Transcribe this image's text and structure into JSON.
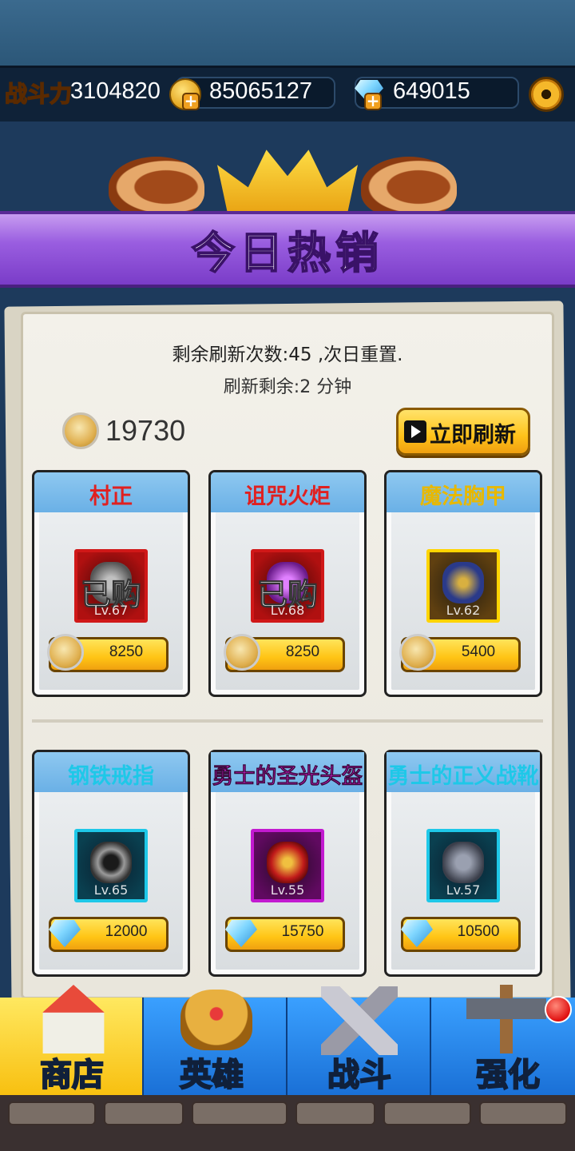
{
  "header": {
    "power_label": "战斗力",
    "power_value": "3104820",
    "gold_value": "85065127",
    "gem_value": "649015",
    "gold_icon": "gold-coin-icon",
    "gem_icon": "diamond-icon",
    "settings_icon": "gear-icon"
  },
  "banner": {
    "title": "今日热销"
  },
  "shop": {
    "refresh_count_text": "剩余刷新次数:45 ,次日重置.",
    "refresh_remain_text": "刷新剩余:2 分钟",
    "honor_value": "19730",
    "refresh_button_label": "立即刷新",
    "items": [
      {
        "name": "村正",
        "name_color": "#e02020",
        "level": "Lv.67",
        "sold": "已购",
        "price": "8250",
        "currency": "honor",
        "frame": "red"
      },
      {
        "name": "诅咒火炬",
        "name_color": "#e02020",
        "level": "Lv.68",
        "sold": "已购",
        "price": "8250",
        "currency": "honor",
        "frame": "red"
      },
      {
        "name": "魔法胸甲",
        "name_color": "#f0c000",
        "level": "Lv.62",
        "sold": "",
        "price": "5400",
        "currency": "honor",
        "frame": "gold"
      },
      {
        "name": "钢铁戒指",
        "name_color": "#1ec8e8",
        "level": "Lv.65",
        "sold": "",
        "price": "12000",
        "currency": "diamond",
        "frame": "cyan"
      },
      {
        "name": "勇士的圣光头盔",
        "name_color": "#e020e0",
        "level": "Lv.55",
        "sold": "",
        "price": "15750",
        "currency": "diamond",
        "frame": "purple"
      },
      {
        "name": "勇士的正义战靴",
        "name_color": "#1ec8e8",
        "level": "Lv.57",
        "sold": "",
        "price": "10500",
        "currency": "diamond",
        "frame": "cyan"
      }
    ]
  },
  "nav": {
    "tabs": [
      {
        "label": "商店",
        "icon": "shop-icon",
        "active": true
      },
      {
        "label": "英雄",
        "icon": "hero-helmet-icon",
        "active": false
      },
      {
        "label": "战斗",
        "icon": "crossed-swords-icon",
        "active": false
      },
      {
        "label": "强化",
        "icon": "forge-hammer-icon",
        "active": false
      }
    ]
  },
  "colors": {
    "accent_gold": "#ffc21a",
    "banner_purple": "#9a5ee0",
    "nav_blue": "#1a70d6"
  }
}
